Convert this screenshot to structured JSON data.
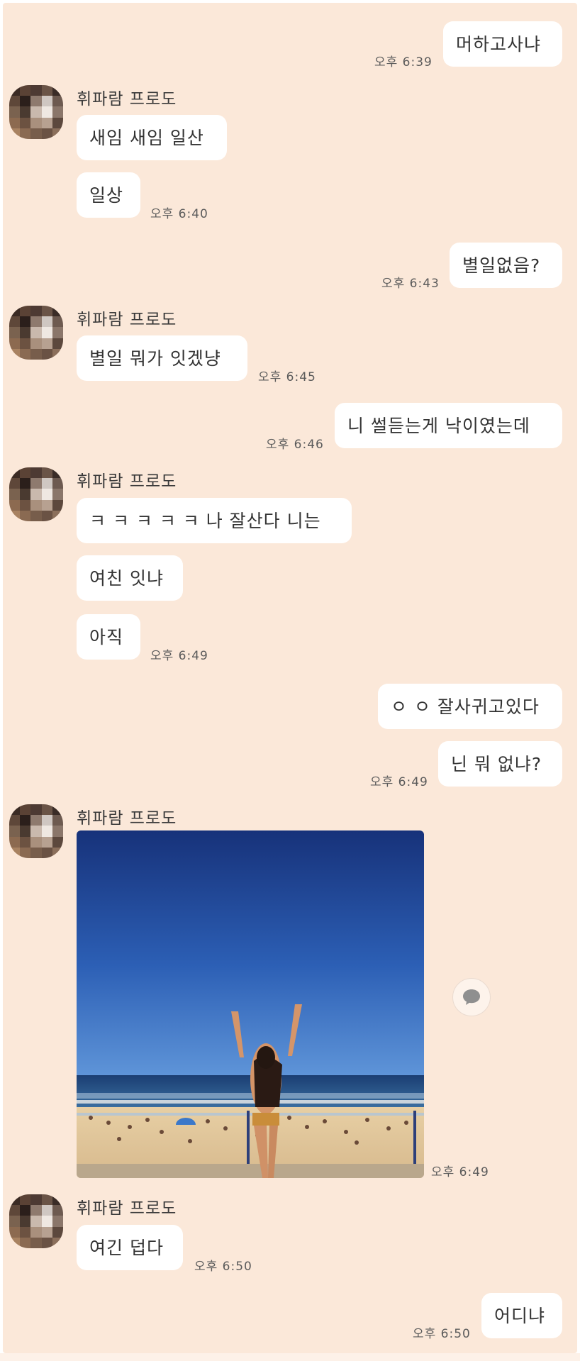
{
  "sender_name": "휘파람 프로도",
  "messages": {
    "m1": {
      "text": "머하고사냐",
      "time": "오후 6:39"
    },
    "m2": {
      "text": "새임 새임 일산"
    },
    "m3": {
      "text": "일상",
      "time": "오후 6:40"
    },
    "m4": {
      "text": "별일없음?",
      "time": "오후 6:43"
    },
    "m5": {
      "text": "별일 뭐가 잇겠냥",
      "time": "오후 6:45"
    },
    "m6": {
      "text": "니 썰듣는게 낙이였는데",
      "time": "오후 6:46"
    },
    "m7": {
      "text": "ㅋ ㅋ ㅋ  ㅋ ㅋ 나 잘산다 니는"
    },
    "m8": {
      "text": "여친 잇냐"
    },
    "m9": {
      "text": "아직",
      "time": "오후 6:49"
    },
    "m10": {
      "text": "ㅇ ㅇ 잘사귀고있다"
    },
    "m11": {
      "text": "닌 뭐 없냐?",
      "time": "오후 6:49"
    },
    "m12": {
      "time": "오후 6:49"
    },
    "m13": {
      "text": "여긴 덥다",
      "time": "오후 6:50"
    },
    "m14": {
      "text": "어디냐",
      "time": "오후 6:50"
    }
  },
  "icons": {
    "share": "speech-bubble-icon",
    "avatar": "pixelated-profile-picture"
  },
  "colors": {
    "background": "#fbe8d9",
    "bubble": "#ffffff",
    "text": "#333333",
    "time": "#5b5b5b"
  }
}
